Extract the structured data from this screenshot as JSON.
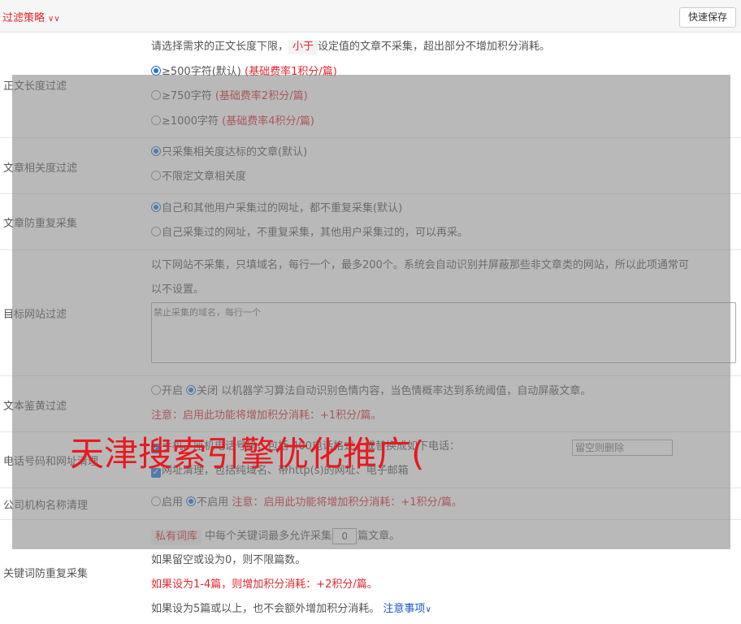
{
  "header": {
    "title": "过滤策略",
    "save_label": "快速保存"
  },
  "sections": {
    "length": {
      "label": "正文长度过滤",
      "desc_pre": "请选择需求的正文长度下限，",
      "desc_tag": "小于",
      "desc_post": "设定值的文章不采集，超出部分不增加积分消耗。",
      "options": [
        {
          "text": "≥500字符(默认)",
          "note": "(基础费率1积分/篇)",
          "checked": true
        },
        {
          "text": "≥750字符",
          "note": "(基础费率2积分/篇)",
          "checked": false
        },
        {
          "text": "≥1000字符",
          "note": "(基础费率4积分/篇)",
          "checked": false
        }
      ]
    },
    "relevance": {
      "label": "文章相关度过滤",
      "options": [
        {
          "text": "只采集相关度达标的文章(默认)",
          "checked": true
        },
        {
          "text": "不限定文章相关度",
          "checked": false
        }
      ]
    },
    "dedup": {
      "label": "文章防重复采集",
      "options": [
        {
          "text": "自己和其他用户采集过的网址，都不重复采集(默认)",
          "checked": true
        },
        {
          "text": "自己采集过的网址，不重复采集，其他用户采集过的，可以再采。",
          "checked": false
        }
      ]
    },
    "sites": {
      "label": "目标网站过滤",
      "desc_line1": "以下网站不采集，只填域名，每行一个，最多200个。系统会自动识别并屏蔽那些非文章类的网站，所以此项通常可",
      "desc_line2": "以不设置。",
      "placeholder": "禁止采集的域名，每行一个"
    },
    "porn": {
      "label": "文本鉴黄过滤",
      "on_text": "开启",
      "off_text": "关闭",
      "off_checked": true,
      "desc": "以机器学习算法自动识别色情内容，当色情概率达到系统阈值，自动屏蔽文章。",
      "note": "注意：启用此功能将增加积分消耗：+1积分/篇。"
    },
    "phone": {
      "label": "电话号码和网址清理",
      "line1": "手机、座机电话号码，包括 400电话格式，或替换成如下电话：",
      "input_placeholder": "留空则删除",
      "line2": "网址清理，包括纯域名、带http(s)的网址、电子邮箱"
    },
    "org": {
      "label": "公司机构名称清理",
      "on_text": "启用",
      "off_text": "不启用",
      "note": "注意：启用此功能将增加积分消耗：+1积分/篇。"
    },
    "keyword": {
      "label": "关键词防重复采集",
      "tag": "私有词库",
      "line1_pre": "中每个关键词最多允许采集",
      "value": "0",
      "line1_post": "篇文章。",
      "line2": "如果留空或设为0，则不限篇数。",
      "line3": "如果设为1-4篇，则增加积分消耗：+2积分/篇。",
      "line4": "如果设为5篇或以上，也不会额外增加积分消耗。",
      "link": "注意事项"
    }
  },
  "watermark": "天津搜索引擎优化推广("
}
